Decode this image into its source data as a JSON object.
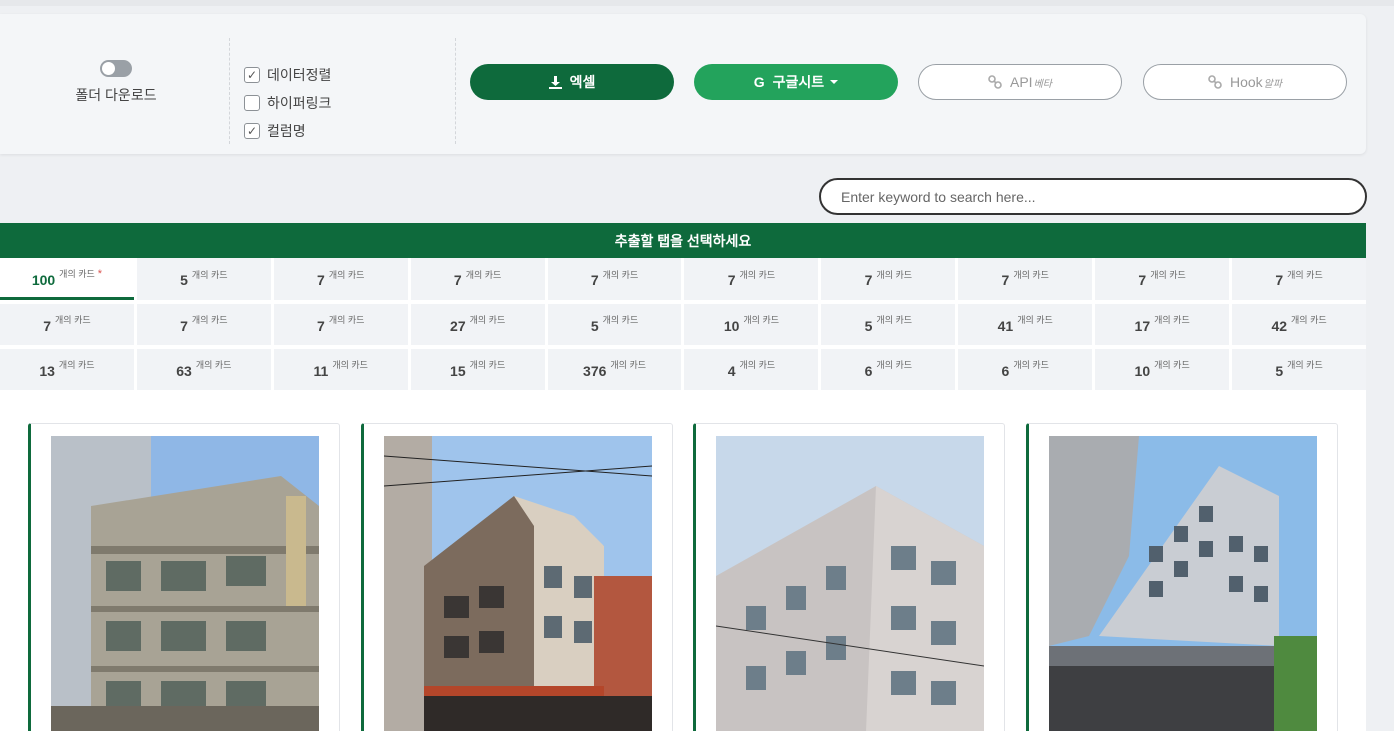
{
  "options": {
    "folder_download_label": "폴더 다운로드",
    "checkboxes": [
      {
        "label": "데이터정렬",
        "checked": true
      },
      {
        "label": "하이퍼링크",
        "checked": false
      },
      {
        "label": "컬럼명",
        "checked": true
      }
    ]
  },
  "buttons": {
    "excel": "엑셀",
    "gsheet": "구글시트",
    "api": "API",
    "api_badge": "베타",
    "hook": "Hook",
    "hook_badge": "알파"
  },
  "search": {
    "placeholder": "Enter keyword to search here..."
  },
  "tab_header": "추출할 탭을 선택하세요",
  "tab_unit": "개의 카드",
  "tabs": [
    {
      "count": "100",
      "active": true,
      "star": "*"
    },
    {
      "count": "5"
    },
    {
      "count": "7"
    },
    {
      "count": "7"
    },
    {
      "count": "7"
    },
    {
      "count": "7"
    },
    {
      "count": "7"
    },
    {
      "count": "7"
    },
    {
      "count": "7"
    },
    {
      "count": "7"
    },
    {
      "count": "7"
    },
    {
      "count": "7"
    },
    {
      "count": "7"
    },
    {
      "count": "27"
    },
    {
      "count": "5"
    },
    {
      "count": "10"
    },
    {
      "count": "5"
    },
    {
      "count": "41"
    },
    {
      "count": "17"
    },
    {
      "count": "42"
    },
    {
      "count": "13"
    },
    {
      "count": "63"
    },
    {
      "count": "11"
    },
    {
      "count": "15"
    },
    {
      "count": "376"
    },
    {
      "count": "4"
    },
    {
      "count": "6"
    },
    {
      "count": "6"
    },
    {
      "count": "10"
    },
    {
      "count": "5"
    }
  ],
  "cards": [
    {
      "image": "building-photo-1"
    },
    {
      "image": "building-photo-2"
    },
    {
      "image": "building-photo-3"
    },
    {
      "image": "building-photo-4"
    }
  ],
  "colors": {
    "brand": "#0e6a3c",
    "accent": "#23a35c"
  }
}
